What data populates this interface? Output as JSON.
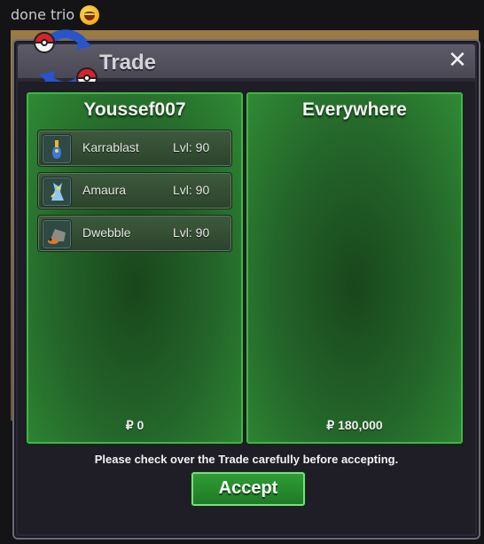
{
  "chat": {
    "message": "done trio",
    "emoji": "grinning-face-emoji"
  },
  "window": {
    "title": "Trade",
    "close_label": "✕",
    "logo_icon": "trade-pokeball-arrows-icon"
  },
  "left_panel": {
    "trainer": "Youssef007",
    "money": "₽ 0",
    "pokemon": [
      {
        "name": "Karrablast",
        "level": "Lvl: 90",
        "icon": "karrablast-sprite-icon"
      },
      {
        "name": "Amaura",
        "level": "Lvl: 90",
        "icon": "amaura-sprite-icon"
      },
      {
        "name": "Dwebble",
        "level": "Lvl: 90",
        "icon": "dwebble-sprite-icon"
      }
    ]
  },
  "right_panel": {
    "trainer": "Everywhere",
    "money": "₽ 180,000",
    "pokemon": []
  },
  "footer": {
    "notice": "Please check over the Trade carefully before accepting.",
    "accept_label": "Accept"
  },
  "colors": {
    "panel_green": "#2f8a34",
    "panel_border": "#43b44a",
    "window_bg": "#2a2834",
    "titlebar": "#5d5b68",
    "accept_button": "#2f9d35"
  }
}
